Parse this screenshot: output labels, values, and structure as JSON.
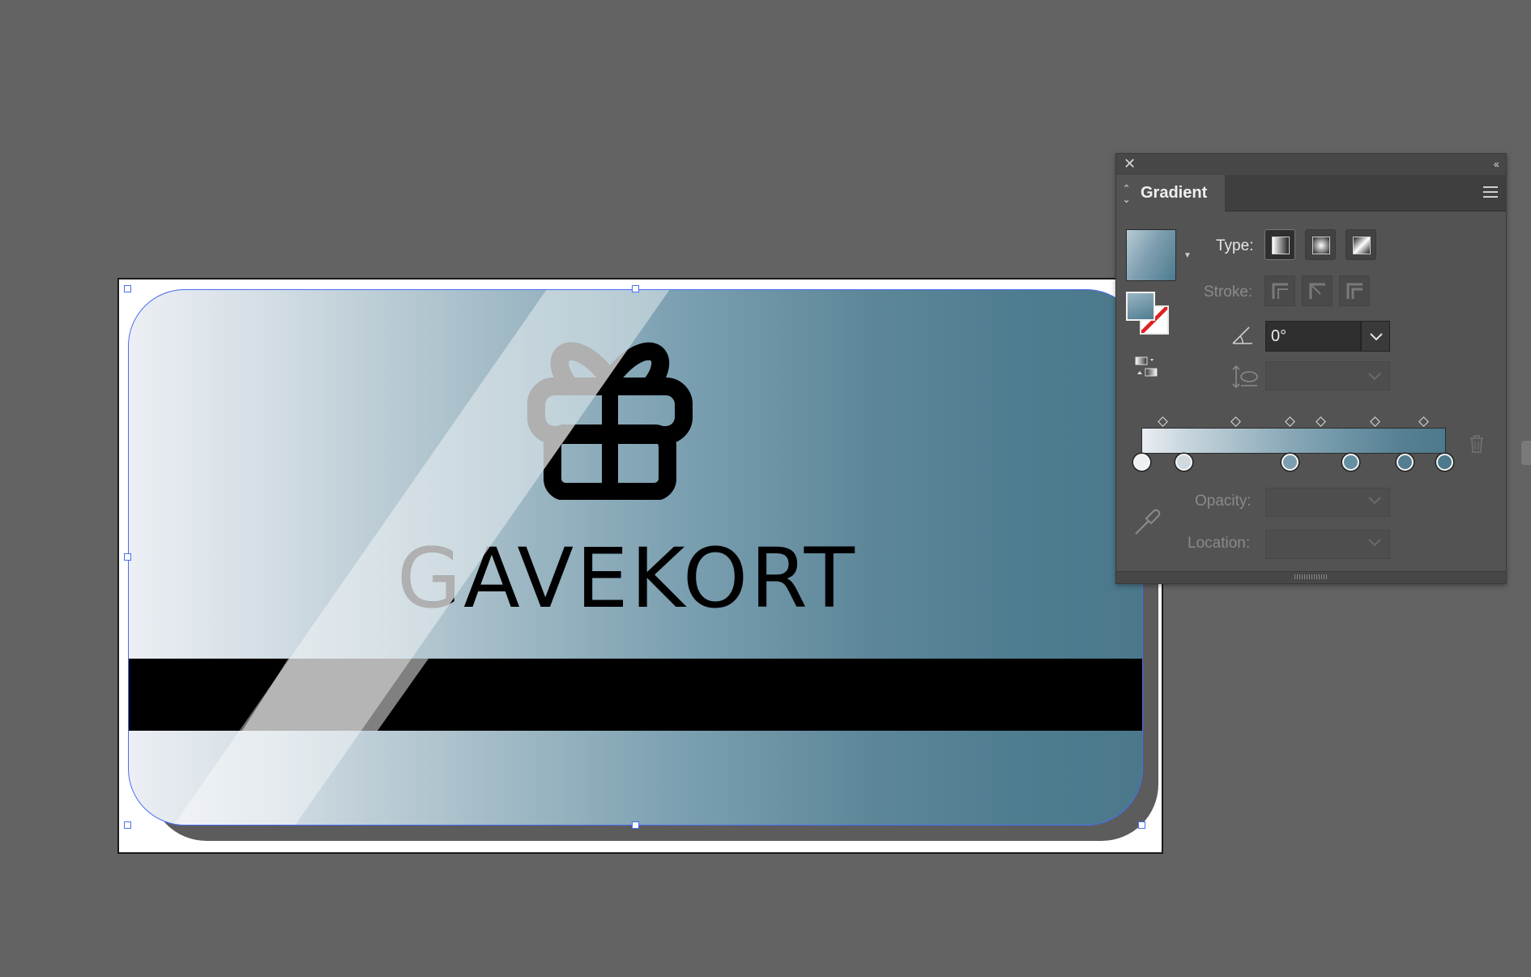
{
  "card": {
    "title": "GAVEKORT",
    "icon": "gift-icon"
  },
  "panel": {
    "close_glyph": "✕",
    "collapse_glyph": "‹‹",
    "tab_label": "Gradient",
    "type_label": "Type:",
    "stroke_label": "Stroke:",
    "angle_value": "0°",
    "opacity_label": "Opacity:",
    "location_label": "Location:",
    "gradient_types": [
      "linear",
      "radial",
      "freeform"
    ],
    "active_type": "linear",
    "stops": [
      {
        "color": "#eef1f4",
        "location": 0
      },
      {
        "color": "#cfd9df",
        "location": 14
      },
      {
        "color": "#7b9fb0",
        "location": 49
      },
      {
        "color": "#6590a2",
        "location": 69
      },
      {
        "color": "#537e92",
        "location": 87
      },
      {
        "color": "#4c798c",
        "location": 100
      }
    ],
    "midpoints": [
      7,
      31,
      49,
      59,
      77,
      93
    ]
  },
  "colors": {
    "canvas": "#636363",
    "selection": "#4a6ef2",
    "panel_bg": "#535353"
  }
}
